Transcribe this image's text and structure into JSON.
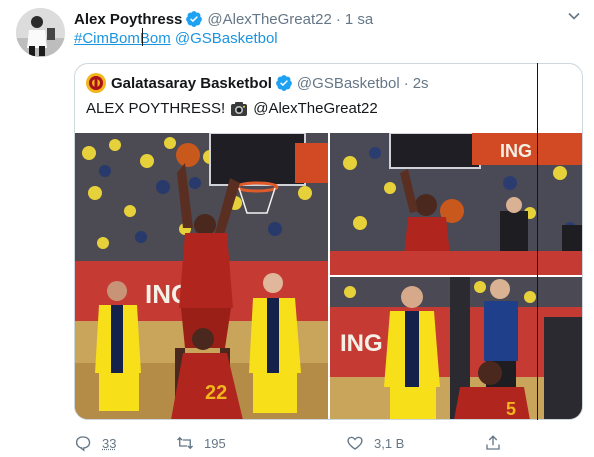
{
  "tweet": {
    "author_name": "Alex Poythress",
    "handle": "@AlexTheGreat22",
    "separator": "·",
    "time": "1 sa",
    "hashtag": "#CimBomBom",
    "mention": "@GSBasketbol"
  },
  "quote": {
    "name": "Galatasaray Basketbol",
    "handle": "@GSBasketbol",
    "separator": "·",
    "time": "2s",
    "text_prefix": "ALEX POYTHRESS!",
    "text_mention": "@AlexTheGreat22",
    "photos": [
      {
        "sponsor": "ING",
        "jersey_visible": "22"
      },
      {
        "sponsor": "ING"
      },
      {
        "sponsor": "ING",
        "jersey_visible": "5"
      }
    ]
  },
  "actions": {
    "reply_count": "33",
    "retweet_count": "195",
    "like_count": "3,1 B"
  },
  "colors": {
    "link": "#1b95e0",
    "muted": "#657786",
    "verified": "#1da1f2",
    "galatasaray_red": "#a9121a",
    "galatasaray_yellow": "#f2b51c",
    "fenerbahce_yellow": "#f7e01a",
    "fenerbahce_navy": "#14214b"
  },
  "icons": {
    "verified": "verified-badge-icon",
    "caret": "chevron-down-icon",
    "reply": "reply-icon",
    "retweet": "retweet-icon",
    "like": "heart-icon",
    "share": "share-icon",
    "camera": "camera-emoji-icon"
  }
}
